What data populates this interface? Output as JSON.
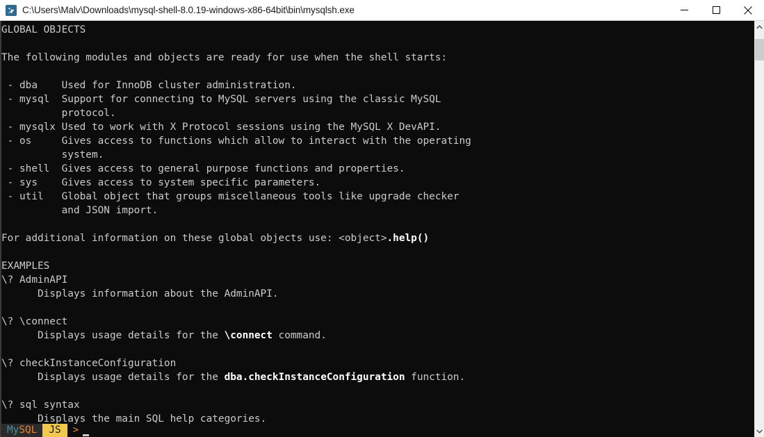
{
  "window": {
    "title": "C:\\Users\\Malv\\Downloads\\mysql-shell-8.0.19-windows-x86-64bit\\bin\\mysqlsh.exe",
    "icon": "mysql-shell-icon",
    "controls": {
      "minimize": "minimize-icon",
      "maximize": "maximize-icon",
      "close": "close-icon"
    }
  },
  "terminal": {
    "background_color": "#0c0c0c",
    "foreground_color": "#cccccc",
    "bold_color": "#ffffff",
    "lines": [
      {
        "segments": [
          {
            "t": "GLOBAL OBJECTS",
            "bold": false
          }
        ]
      },
      {
        "segments": [
          {
            "t": "",
            "bold": false
          }
        ]
      },
      {
        "segments": [
          {
            "t": "The following modules and objects are ready for use when the shell starts:",
            "bold": false
          }
        ]
      },
      {
        "segments": [
          {
            "t": "",
            "bold": false
          }
        ]
      },
      {
        "segments": [
          {
            "t": " - dba    Used for InnoDB cluster administration.",
            "bold": false
          }
        ]
      },
      {
        "segments": [
          {
            "t": " - mysql  Support for connecting to MySQL servers using the classic MySQL",
            "bold": false
          }
        ]
      },
      {
        "segments": [
          {
            "t": "          protocol.",
            "bold": false
          }
        ]
      },
      {
        "segments": [
          {
            "t": " - mysqlx Used to work with X Protocol sessions using the MySQL X DevAPI.",
            "bold": false
          }
        ]
      },
      {
        "segments": [
          {
            "t": " - os     Gives access to functions which allow to interact with the operating",
            "bold": false
          }
        ]
      },
      {
        "segments": [
          {
            "t": "          system.",
            "bold": false
          }
        ]
      },
      {
        "segments": [
          {
            "t": " - shell  Gives access to general purpose functions and properties.",
            "bold": false
          }
        ]
      },
      {
        "segments": [
          {
            "t": " - sys    Gives access to system specific parameters.",
            "bold": false
          }
        ]
      },
      {
        "segments": [
          {
            "t": " - util   Global object that groups miscellaneous tools like upgrade checker",
            "bold": false
          }
        ]
      },
      {
        "segments": [
          {
            "t": "          and JSON import.",
            "bold": false
          }
        ]
      },
      {
        "segments": [
          {
            "t": "",
            "bold": false
          }
        ]
      },
      {
        "segments": [
          {
            "t": "For additional information on these global objects use: <object>",
            "bold": false
          },
          {
            "t": ".help()",
            "bold": true
          }
        ]
      },
      {
        "segments": [
          {
            "t": "",
            "bold": false
          }
        ]
      },
      {
        "segments": [
          {
            "t": "EXAMPLES",
            "bold": false
          }
        ]
      },
      {
        "segments": [
          {
            "t": "\\? AdminAPI",
            "bold": false
          }
        ]
      },
      {
        "segments": [
          {
            "t": "      Displays information about the AdminAPI.",
            "bold": false
          }
        ]
      },
      {
        "segments": [
          {
            "t": "",
            "bold": false
          }
        ]
      },
      {
        "segments": [
          {
            "t": "\\? \\connect",
            "bold": false
          }
        ]
      },
      {
        "segments": [
          {
            "t": "      Displays usage details for the ",
            "bold": false
          },
          {
            "t": "\\connect",
            "bold": true
          },
          {
            "t": " command.",
            "bold": false
          }
        ]
      },
      {
        "segments": [
          {
            "t": "",
            "bold": false
          }
        ]
      },
      {
        "segments": [
          {
            "t": "\\? checkInstanceConfiguration",
            "bold": false
          }
        ]
      },
      {
        "segments": [
          {
            "t": "      Displays usage details for the ",
            "bold": false
          },
          {
            "t": "dba.checkInstanceConfiguration",
            "bold": true
          },
          {
            "t": " function.",
            "bold": false
          }
        ]
      },
      {
        "segments": [
          {
            "t": "",
            "bold": false
          }
        ]
      },
      {
        "segments": [
          {
            "t": "\\? sql syntax",
            "bold": false
          }
        ]
      },
      {
        "segments": [
          {
            "t": "      Displays the main SQL help categories.",
            "bold": false
          }
        ]
      }
    ]
  },
  "prompt": {
    "brand_my": "My",
    "brand_sql": "SQL",
    "mode": "JS",
    "chevron": ">",
    "input_value": "",
    "colors": {
      "brand_my": "#3a96a8",
      "brand_sql": "#e8812e",
      "mode_bg": "#f2c94c",
      "mode_fg": "#1a1a1a",
      "chevron": "#e8812e"
    }
  },
  "scrollbar": {
    "up_arrow": "chevron-up-icon",
    "down_arrow": "chevron-down-icon",
    "thumb": "scrollbar-thumb"
  }
}
